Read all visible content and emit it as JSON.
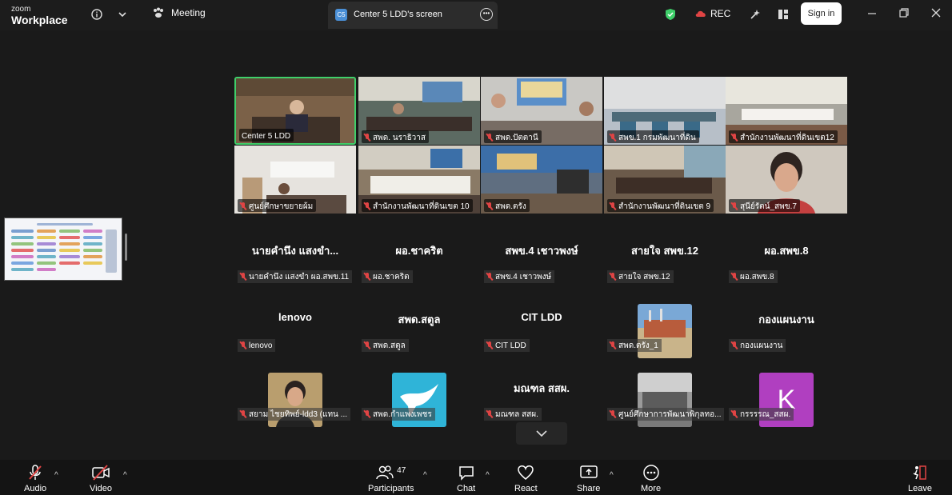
{
  "app": {
    "brand_small": "zoom",
    "brand_big": "Workplace"
  },
  "topbar": {
    "meeting_label": "Meeting",
    "screen_tab_badge": "C5",
    "screen_tab_title": "Center 5 LDD's screen",
    "rec_label": "REC",
    "signin_label": "Sign in"
  },
  "video_tiles": [
    {
      "label": "Center 5 LDD",
      "muted": false,
      "bg": "#6d5a45",
      "active": true
    },
    {
      "label": "สพด. นราธิวาส",
      "muted": true,
      "bg": "#5c6a62"
    },
    {
      "label": "สพด.ปัตตานี",
      "muted": true,
      "bg": "#8a8f98"
    },
    {
      "label": "สพข.1 กรมพัฒนาที่ดิน",
      "muted": true,
      "bg": "#4d6a78"
    },
    {
      "label": "สำนักงานพัฒนาที่ดินเขต12",
      "muted": true,
      "bg": "#9aa09a"
    },
    {
      "label": "ศูนย์ศึกษาขยายผ้ม",
      "muted": true,
      "bg": "#b7a98f"
    },
    {
      "label": "สำนักงานพัฒนาที่ดินเขต 10",
      "muted": true,
      "bg": "#7a6a55"
    },
    {
      "label": "สพด.ตรัง",
      "muted": true,
      "bg": "#5f6e80"
    },
    {
      "label": "สำนักงานพัฒนาที่ดินเขต 9",
      "muted": true,
      "bg": "#6b5a4a"
    },
    {
      "label": "สุนีย์รัตน์_สพข.7",
      "muted": true,
      "bg": "#c9c0b5"
    }
  ],
  "name_tiles_row1": [
    {
      "name": "นายคำนึง แสงขำ...",
      "label": "นายคำนึง แสงขำ ผอ.สพข.11"
    },
    {
      "name": "ผอ.ชาคริต",
      "label": "ผอ.ชาคริต"
    },
    {
      "name": "สพข.4 เชาวพงษ์",
      "label": "สพข.4 เชาวพงษ์"
    },
    {
      "name": "สายใจ สพข.12",
      "label": "สายใจ สพข.12"
    },
    {
      "name": "ผอ.สพข.8",
      "label": "ผอ.สพข.8"
    }
  ],
  "name_tiles_row2": [
    {
      "name": "lenovo",
      "label": "lenovo"
    },
    {
      "name": "สพด.สตูล",
      "label": "สพด.สตูล"
    },
    {
      "name": "CIT LDD",
      "label": "CIT LDD"
    },
    {
      "name": "",
      "label": "สพด.ตรัง_1"
    },
    {
      "name": "กองแผนงาน",
      "label": "กองแผนงาน"
    }
  ],
  "name_tiles_row3": [
    {
      "name": "",
      "label": "สยาม ไชยทิพย์-ldd3 (แทน ..."
    },
    {
      "name": "",
      "label": "สพด.กำแพงเพชร"
    },
    {
      "name": "มณฑล สสผ.",
      "label": "มณฑล สสผ."
    },
    {
      "name": "",
      "label": "ศูนย์ศึกษาการพัฒนาพิกุลทอ..."
    },
    {
      "name": "",
      "label": "กรรรรณ_สสผ.",
      "avatar_letter": "K"
    }
  ],
  "bottombar": {
    "audio": "Audio",
    "video": "Video",
    "participants": "Participants",
    "participants_count": "47",
    "chat": "Chat",
    "react": "React",
    "share": "Share",
    "more": "More",
    "leave": "Leave"
  },
  "colors": {
    "active_border": "#3fcf6a",
    "mute_red": "#e04444",
    "share_green": "#3fcf6a"
  }
}
